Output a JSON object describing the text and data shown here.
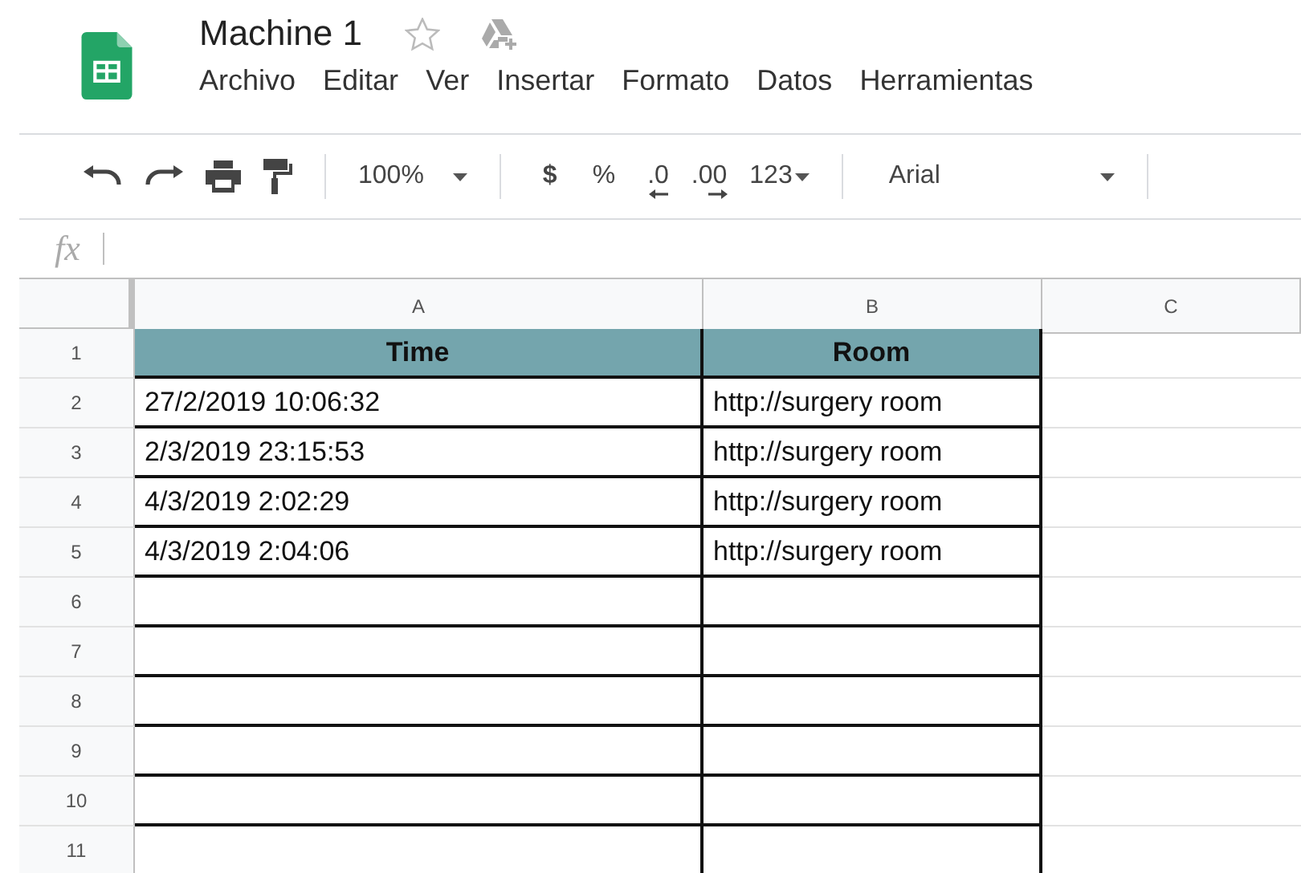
{
  "document": {
    "title": "Machine 1",
    "starred": false
  },
  "menu": [
    "Archivo",
    "Editar",
    "Ver",
    "Insertar",
    "Formato",
    "Datos",
    "Herramientas"
  ],
  "toolbar": {
    "zoom": "100%",
    "currency": "$",
    "percent": "%",
    "decrease_decimals": ".0",
    "increase_decimals": ".00",
    "number_format": "123",
    "font": "Arial"
  },
  "formula_bar": {
    "label": "fx"
  },
  "columns": [
    "A",
    "B",
    "C"
  ],
  "rows": [
    {
      "number": "1",
      "kind": "header",
      "cells": [
        "Time",
        "Room"
      ]
    },
    {
      "number": "2",
      "kind": "data",
      "cells": [
        "27/2/2019 10:06:32",
        "http://surgery room"
      ]
    },
    {
      "number": "3",
      "kind": "data",
      "cells": [
        "2/3/2019 23:15:53",
        "http://surgery room"
      ]
    },
    {
      "number": "4",
      "kind": "data",
      "cells": [
        "4/3/2019 2:02:29",
        "http://surgery room"
      ]
    },
    {
      "number": "5",
      "kind": "data",
      "cells": [
        "4/3/2019 2:04:06",
        "http://surgery room"
      ]
    },
    {
      "number": "6",
      "kind": "data",
      "cells": [
        "",
        ""
      ]
    },
    {
      "number": "7",
      "kind": "data",
      "cells": [
        "",
        ""
      ]
    },
    {
      "number": "8",
      "kind": "data",
      "cells": [
        "",
        ""
      ]
    },
    {
      "number": "9",
      "kind": "data",
      "cells": [
        "",
        ""
      ]
    },
    {
      "number": "10",
      "kind": "data",
      "cells": [
        "",
        ""
      ]
    },
    {
      "number": "11",
      "kind": "data",
      "cells": [
        "",
        ""
      ]
    }
  ]
}
